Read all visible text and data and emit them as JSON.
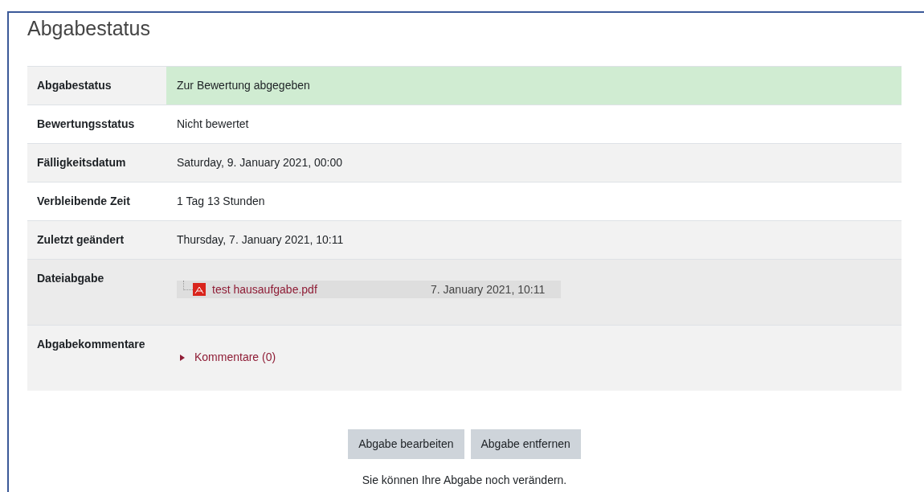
{
  "heading": "Abgabestatus",
  "rows": [
    {
      "label": "Abgabestatus",
      "kind": "text",
      "value": "Zur Bewertung abgegeben",
      "highlighted": true
    },
    {
      "label": "Bewertungsstatus",
      "kind": "text",
      "value": "Nicht bewertet",
      "highlighted": false
    },
    {
      "label": "Fälligkeitsdatum",
      "kind": "text",
      "value": "Saturday, 9. January 2021, 00:00",
      "highlighted": false
    },
    {
      "label": "Verbleibende Zeit",
      "kind": "text",
      "value": "1 Tag 13 Stunden",
      "highlighted": false
    },
    {
      "label": "Zuletzt geändert",
      "kind": "text",
      "value": "Thursday, 7. January 2021, 10:11",
      "highlighted": false
    },
    {
      "label": "Dateiabgabe",
      "kind": "file",
      "file": "test hausaufgabe.pdf",
      "date": "7. January 2021, 10:11",
      "highlighted": false
    },
    {
      "label": "Abgabekommentare",
      "kind": "comments",
      "link": "Kommentare (0)",
      "expanded": false,
      "highlighted": false
    }
  ],
  "buttons": [
    "Abgabe bearbeiten",
    "Abgabe entfernen"
  ],
  "note": "Sie können Ihre Abgabe noch verändern."
}
